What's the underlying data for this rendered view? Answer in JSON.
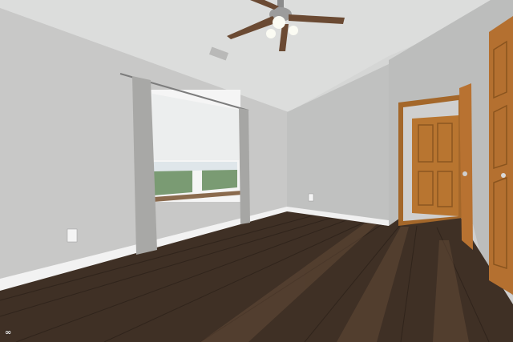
{
  "scene": {
    "description_label": "",
    "colors": {
      "wall_left": "#c9c9c8",
      "wall_back": "#c3c4c3",
      "wall_right": "#bdbebd",
      "ceiling": "#dedfde",
      "floor_dark": "#3a2c22",
      "floor_light": "#5c4634",
      "trim": "#f2f2f2",
      "wood_door": "#b8742e",
      "curtain": "#a9a9a7",
      "window_glass": "#eef1f2",
      "fan_blade": "#6b4a33"
    },
    "watermark": {
      "text": "∞"
    }
  }
}
